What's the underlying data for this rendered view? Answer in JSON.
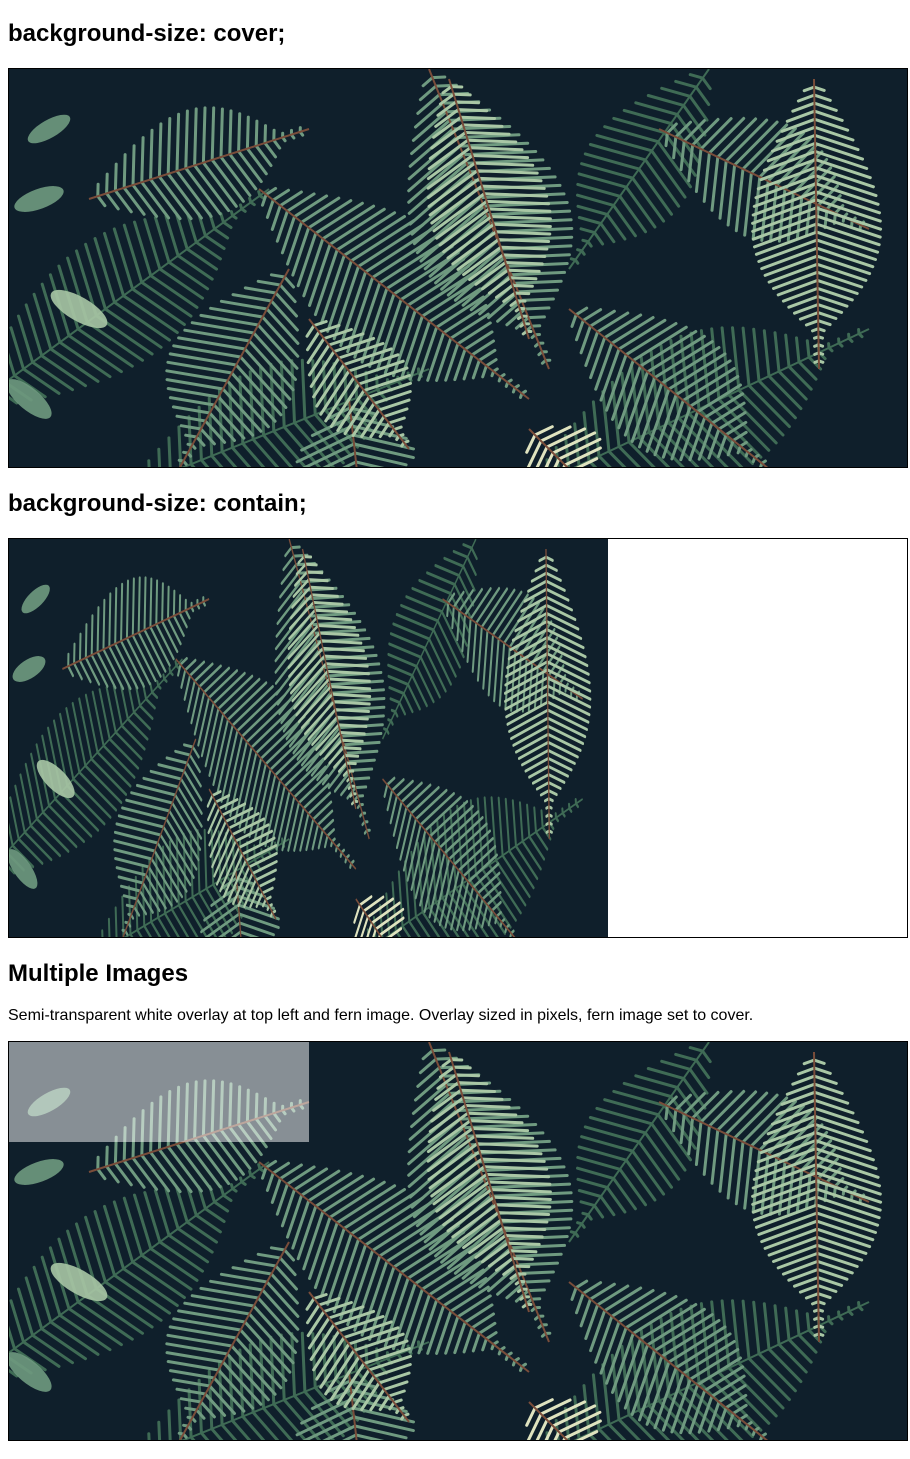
{
  "sections": {
    "cover": {
      "heading": "background-size: cover;"
    },
    "contain": {
      "heading": "background-size: contain;"
    },
    "multiple": {
      "heading": "Multiple Images",
      "description": "Semi-transparent white overlay at top left and fern image. Overlay sized in pixels, fern image set to cover."
    }
  },
  "image": {
    "subject": "fern-leaves-photo",
    "colors": {
      "background": "#0f1f2b",
      "leaf_dark": "#3f6b55",
      "leaf_mid": "#6f9a80",
      "leaf_light": "#a9c7a5",
      "leaf_pale": "#dfe3bf",
      "stem": "#7a4d3a"
    }
  },
  "overlay": {
    "color": "#ffffff",
    "opacity": 0.5
  }
}
